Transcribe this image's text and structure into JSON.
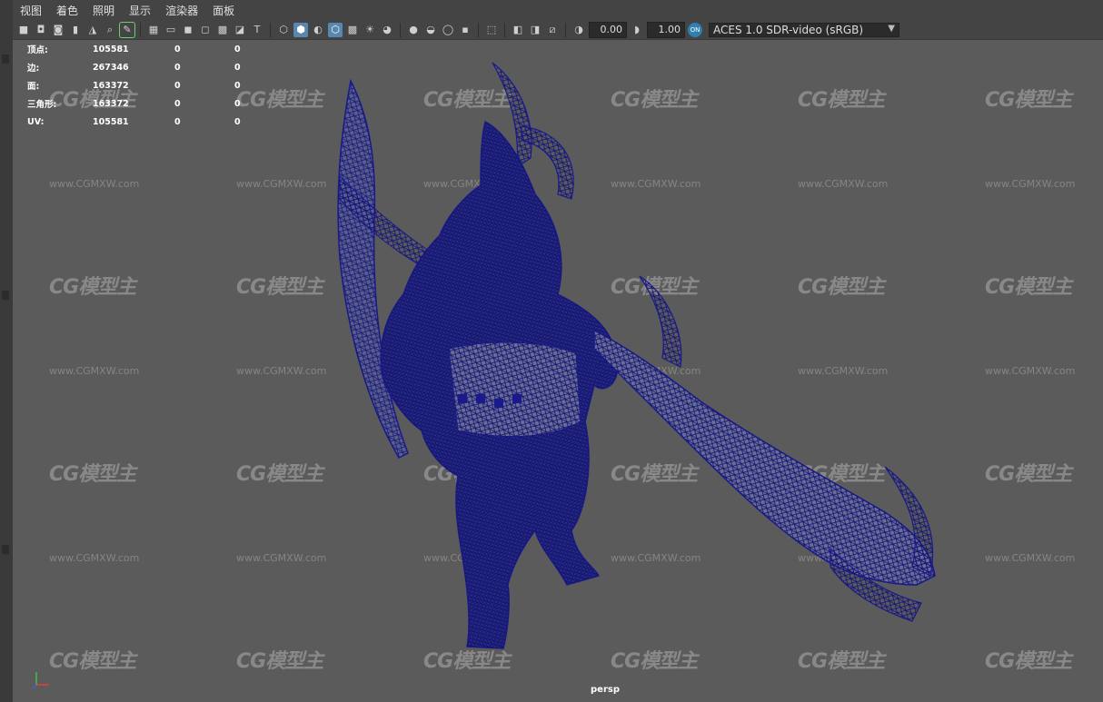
{
  "menu": {
    "items": [
      "视图",
      "着色",
      "照明",
      "显示",
      "渲染器",
      "面板"
    ]
  },
  "toolbar": {
    "exposure_value": "0.00",
    "gamma_value": "1.00",
    "color_space": "ACES 1.0 SDR-video (sRGB)",
    "ocio_badge": "ON"
  },
  "hud": {
    "rows": [
      {
        "label": "顶点:",
        "v1": "105581",
        "v2": "0",
        "v3": "0"
      },
      {
        "label": "边:",
        "v1": "267346",
        "v2": "0",
        "v3": "0"
      },
      {
        "label": "面:",
        "v1": "163372",
        "v2": "0",
        "v3": "0"
      },
      {
        "label": "三角形:",
        "v1": "163372",
        "v2": "0",
        "v3": "0"
      },
      {
        "label": "UV:",
        "v1": "105581",
        "v2": "0",
        "v3": "0"
      }
    ]
  },
  "watermark": {
    "logo": "CG模型主",
    "url": "www.CGMXW.com"
  },
  "viewport": {
    "camera": "persp",
    "wire_color": "#1a1a8c",
    "bg_color": "#5b5b5b"
  },
  "icons": [
    "camera-icon",
    "lock-camera-icon",
    "bookmark-icon",
    "grid-icon",
    "film-gate-icon",
    "wireframe-icon",
    "smooth-shade-icon",
    "xray-icon",
    "light-icon",
    "shadow-icon",
    "isolate-icon",
    "exposure-icon",
    "gamma-icon"
  ]
}
